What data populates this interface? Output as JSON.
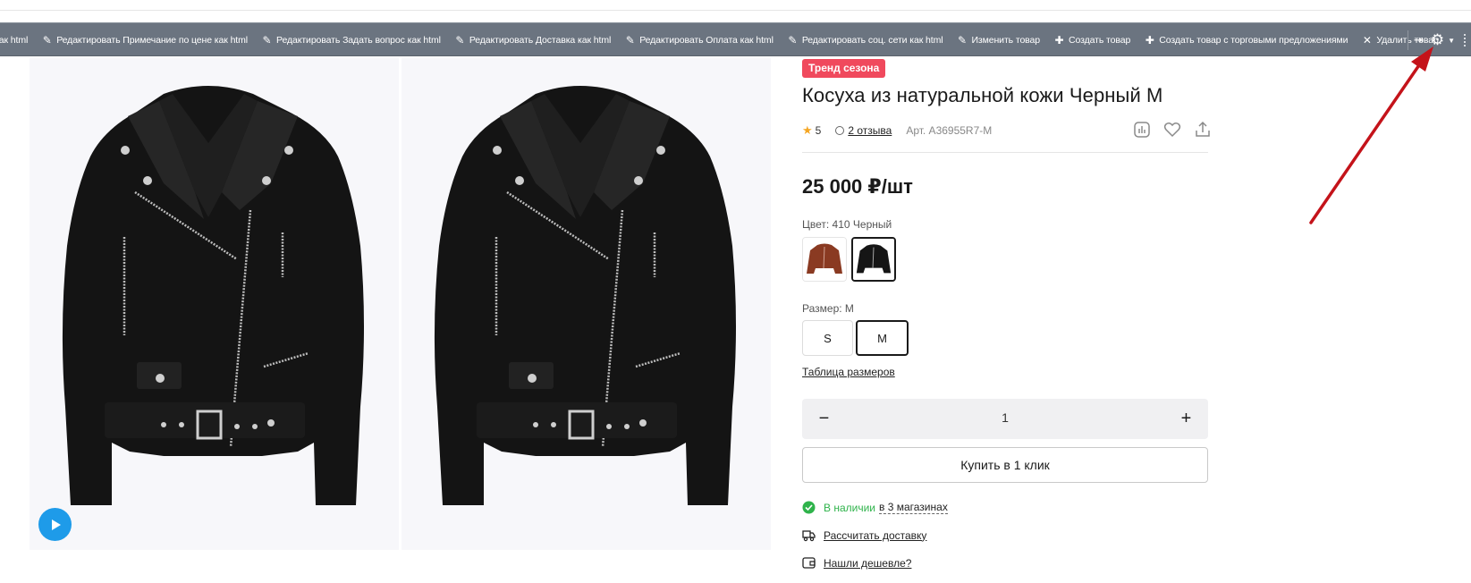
{
  "admin_toolbar": {
    "items": [
      {
        "icon": "none",
        "label": "как html"
      },
      {
        "icon": "pencil-icon",
        "label": "Редактировать Примечание по цене как html"
      },
      {
        "icon": "pencil-icon",
        "label": "Редактировать Задать вопрос как html"
      },
      {
        "icon": "pencil-icon",
        "label": "Редактировать Доставка как html"
      },
      {
        "icon": "pencil-icon",
        "label": "Редактировать Оплата как html"
      },
      {
        "icon": "pencil-icon",
        "label": "Редактировать соц. сети как html"
      },
      {
        "icon": "pencil-icon",
        "label": "Изменить товар"
      },
      {
        "icon": "plus-icon",
        "label": "Создать товар"
      },
      {
        "icon": "plus-icon",
        "label": "Создать товар с торговыми предложениями"
      },
      {
        "icon": "close-icon",
        "label": "Удалить товар"
      }
    ],
    "right_icons": [
      "pin-icon",
      "gear-icon",
      "chevron-down-icon"
    ]
  },
  "product": {
    "badge": "Тренд сезона",
    "title": "Косуха из натуральной кожи Черный M",
    "rating": "5",
    "reviews": "2 отзыва",
    "sku": "Арт. A36955R7-M",
    "price": "25 000 ₽/шт",
    "color_label": "Цвет: 410 Черный",
    "colors": [
      "brown",
      "black"
    ],
    "selected_color": "black",
    "size_label": "Размер: M",
    "sizes": [
      "S",
      "M"
    ],
    "selected_size": "M",
    "size_table_link": "Таблица размеров",
    "quantity": "1",
    "qty_minus": "−",
    "qty_plus": "+",
    "buy_one_click": "Купить в 1 клик",
    "availability_status": "В наличии",
    "availability_where": "в 3 магазинах",
    "delivery_link": "Рассчитать доставку",
    "cheaper_link": "Нашли дешевле?"
  },
  "colors": {
    "toolbar_bg": "#6b7480",
    "badge_bg": "#f0495d",
    "in_stock": "#2fb34b",
    "play_button": "#1e9be9",
    "annotation_arrow": "#c4131a"
  }
}
